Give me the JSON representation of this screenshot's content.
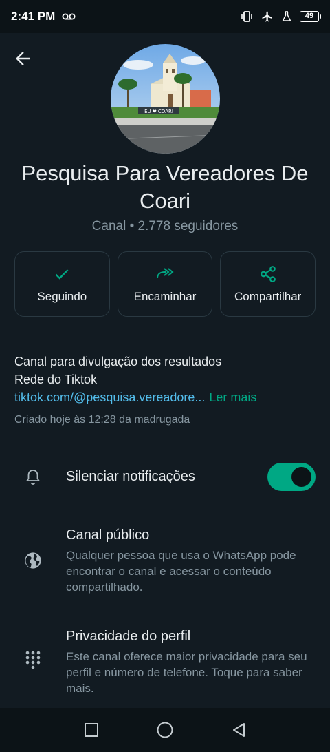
{
  "status_bar": {
    "time": "2:41 PM",
    "battery": "49"
  },
  "channel": {
    "name": "Pesquisa Para Vereadores De Coari",
    "subtitle": "Canal • 2.778 seguidores",
    "avatar_sign_text": "EU ❤ COARI"
  },
  "actions": [
    {
      "label": "Seguindo",
      "icon": "check-icon"
    },
    {
      "label": "Encaminhar",
      "icon": "forward-icon"
    },
    {
      "label": "Compartilhar",
      "icon": "share-icon"
    }
  ],
  "description": {
    "line1": "Canal para divulgação dos resultados",
    "line2": "Rede do Tiktok",
    "link": "tiktok.com/@pesquisa.vereadore...",
    "read_more": "Ler mais"
  },
  "created": "Criado hoje às 12:28 da madrugada",
  "settings": {
    "mute": {
      "title": "Silenciar notificações",
      "enabled": true,
      "icon": "bell-icon"
    },
    "public": {
      "title": "Canal público",
      "subtitle": "Qualquer pessoa que usa o WhatsApp pode encontrar o canal e acessar o conteúdo compartilhado.",
      "icon": "globe-icon"
    },
    "privacy": {
      "title": "Privacidade do perfil",
      "subtitle": "Este canal oferece maior privacidade para seu perfil e número de telefone. Toque para saber mais.",
      "icon": "dialpad-icon"
    }
  },
  "colors": {
    "accent": "#00a884",
    "link": "#53bdeb",
    "background": "#121b22"
  }
}
